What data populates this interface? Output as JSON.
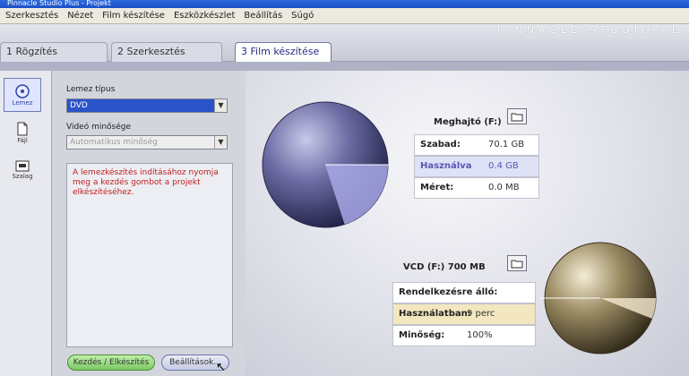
{
  "window": {
    "title": "Pinnacle Studio Plus - Projekt"
  },
  "menu": [
    "Szerkesztés",
    "Nézet",
    "Film készítése",
    "Eszközkészlet",
    "Beállítás",
    "Súgó"
  ],
  "tabs": [
    {
      "label": "1 Rögzítés"
    },
    {
      "label": "2 Szerkesztés"
    },
    {
      "label": "3 Film készítése",
      "active": true
    }
  ],
  "brand": "PINNACLE STUDIO PL",
  "tools": [
    {
      "label": "Lemez",
      "icon": "disc-icon",
      "active": true
    },
    {
      "label": "Fájl",
      "icon": "file-icon"
    },
    {
      "label": "Szalag",
      "icon": "tape-icon"
    }
  ],
  "format": {
    "label": "Lemez típus",
    "value": "DVD"
  },
  "quality": {
    "label": "Videó minősége",
    "value": "Automatikus minőség"
  },
  "message": "A lemezkészítés indításához nyomja meg a kezdés gombot a projekt elkészítéséhez.",
  "buttons": {
    "start": "Kezdés / Elkészítés",
    "settings": "Beállítások..."
  },
  "drive": {
    "title": "Meghajtó (F:)",
    "rows": [
      {
        "key": "Szabad:",
        "value": "70.1 GB"
      },
      {
        "key": "Használva",
        "value": "0.4 GB"
      },
      {
        "key": "Méret:",
        "value": "0.0 MB"
      }
    ],
    "used_fraction": 0.2
  },
  "disc": {
    "title": "VCD (F:) 700 MB",
    "rows": [
      {
        "key": "Rendelkezésre álló:",
        "value": ""
      },
      {
        "key": "Használatban:",
        "value": "9 perc"
      },
      {
        "key": "Minőség:",
        "value": "100%"
      }
    ],
    "used_fraction": 0.06
  },
  "colors": {
    "accent": "#2a53c9",
    "used": "#5a55b8",
    "disc_used": "#f2e7bf"
  }
}
